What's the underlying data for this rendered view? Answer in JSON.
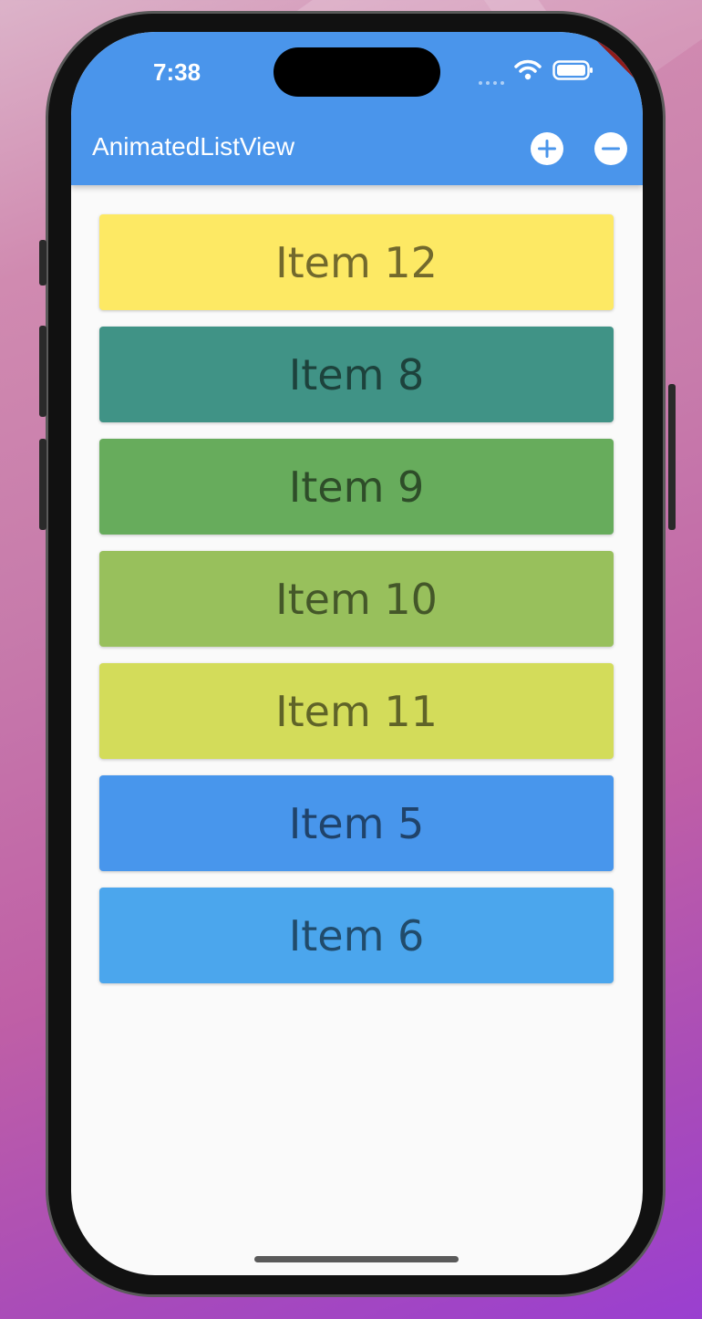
{
  "status_bar": {
    "time": "7:38"
  },
  "app_bar": {
    "title": "AnimatedListView",
    "add_icon": "add-circle-icon",
    "remove_icon": "remove-circle-icon",
    "color": "#4a95eb"
  },
  "debug_banner": "DEBUG",
  "items": [
    {
      "label": "Item 12",
      "color": "#fde964"
    },
    {
      "label": "Item 8",
      "color": "#409386"
    },
    {
      "label": "Item 9",
      "color": "#67ac5c"
    },
    {
      "label": "Item 10",
      "color": "#98c05c"
    },
    {
      "label": "Item 11",
      "color": "#d3dc5a"
    },
    {
      "label": "Item 5",
      "color": "#4896ec"
    },
    {
      "label": "Item 6",
      "color": "#4ba6ed"
    }
  ]
}
